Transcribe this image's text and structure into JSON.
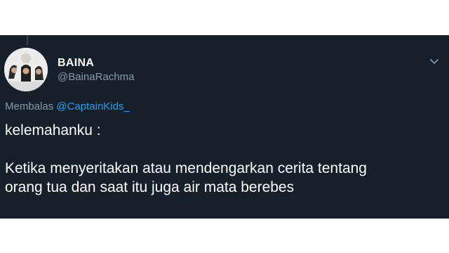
{
  "user": {
    "display_name": "BAINA",
    "handle": "@BainaRachma",
    "avatar_icon": "profile-photo"
  },
  "reply": {
    "prefix": "Membalas",
    "mention": "@CaptainKids_"
  },
  "tweet": {
    "line1": "kelemahanku :",
    "line2": "Ketika menyeritakan atau mendengarkan cerita tentang",
    "line3": "orang tua dan saat itu juga air mata berebes"
  },
  "colors": {
    "background": "#15202b",
    "text": "#ffffff",
    "secondary_text": "#8899a6",
    "link": "#1da1f2",
    "thread_line": "#38444d"
  },
  "icons": {
    "menu": "chevron-down-icon"
  }
}
